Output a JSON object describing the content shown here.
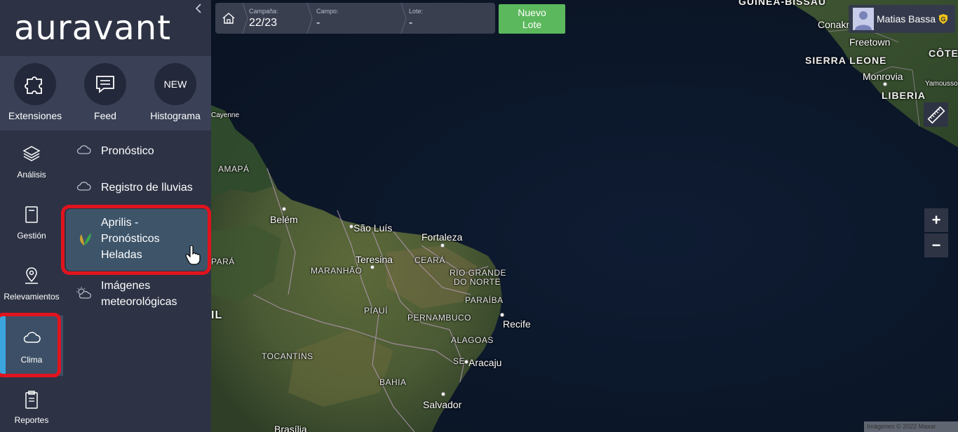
{
  "app": {
    "logo": "auravant"
  },
  "quick_bar": [
    {
      "label": "Extensiones",
      "icon": "puzzle-icon"
    },
    {
      "label": "Feed",
      "icon": "chat-icon"
    },
    {
      "label": "Histograma",
      "icon": "new-badge",
      "badge": "NEW"
    }
  ],
  "nav": [
    {
      "label": "Análisis",
      "icon": "layers-icon"
    },
    {
      "label": "Gestión",
      "icon": "book-icon"
    },
    {
      "label": "Relevamientos",
      "icon": "map-pin-icon"
    },
    {
      "label": "Clima",
      "icon": "cloud-icon",
      "active": true
    },
    {
      "label": "Reportes",
      "icon": "clipboard-icon"
    }
  ],
  "submenu": [
    {
      "label": "Pronóstico",
      "icon": "cloud-icon"
    },
    {
      "label": "Registro de lluvias",
      "icon": "cloud-icon"
    },
    {
      "label": "Aprilis - Pronósticos Heladas",
      "icon": "leaf-icon",
      "active": true
    },
    {
      "label": "Imágenes meteorológicas",
      "icon": "sun-cloud-icon"
    }
  ],
  "topbar": {
    "campaign": {
      "label": "Campaña:",
      "value": "22/23"
    },
    "field": {
      "label": "Campo:",
      "value": "-"
    },
    "lot": {
      "label": "Lote:",
      "value": "-"
    },
    "new_lot_line1": "Nuevo",
    "new_lot_line2": "Lote"
  },
  "user": {
    "name": "Matias Bassa",
    "badge": "G"
  },
  "map": {
    "zoom_in": "+",
    "zoom_out": "−",
    "attribution": "Imágenes © 2022 Maxar",
    "labels": {
      "guinea_bissau": "GUINEA-BISSAU",
      "conakry": "Conakry",
      "freetown": "Freetown",
      "sierra_leone": "SIERRA LEONE",
      "monrovia": "Monrovia",
      "cote": "CÔTE",
      "yamoussoukro": "Yamoussou",
      "liberia": "LIBERIA",
      "cayenne": "Cayenne",
      "amapa": "AMAPÁ",
      "belem": "Belém",
      "sao_luis": "São Luís",
      "fortaleza": "Fortaleza",
      "para": "PARÁ",
      "teresina": "Teresina",
      "maranhao": "MARANHÃO",
      "ceara": "CEARÁ",
      "rio_grande_1": "RIO GRANDE",
      "rio_grande_2": "DO NORTE",
      "paraiba": "PARAÍBA",
      "piaui": "PIAUÍ",
      "pernambuco": "PERNAMBUCO",
      "recife": "Recife",
      "brasil": "IL",
      "alagoas": "ALAGOAS",
      "tocantins": "TOCANTINS",
      "se": "SE",
      "aracaju": "Aracaju",
      "bahia": "BAHIA",
      "salvador": "Salvador",
      "brasilia": "Brasília"
    }
  }
}
